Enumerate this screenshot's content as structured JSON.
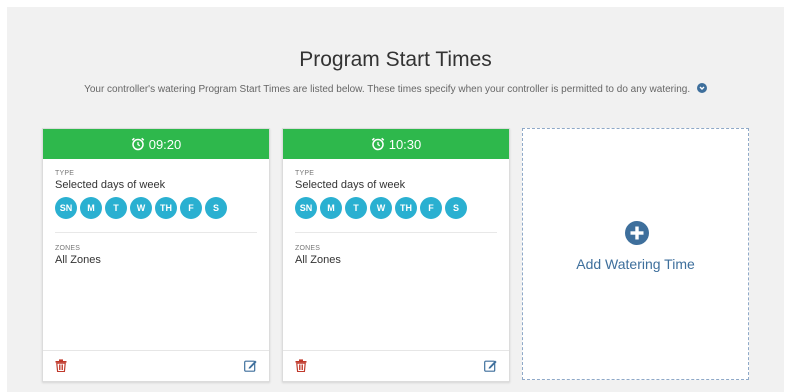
{
  "page": {
    "title": "Program Start Times",
    "subtitle": "Your controller's watering Program Start Times are listed below. These times specify when your controller is permitted to do any watering."
  },
  "cards": [
    {
      "time": "09:20",
      "type_label": "TYPE",
      "type_value": "Selected days of week",
      "days": [
        "SN",
        "M",
        "T",
        "W",
        "TH",
        "F",
        "S"
      ],
      "zones_label": "ZONES",
      "zones_value": "All Zones"
    },
    {
      "time": "10:30",
      "type_label": "TYPE",
      "type_value": "Selected days of week",
      "days": [
        "SN",
        "M",
        "T",
        "W",
        "TH",
        "F",
        "S"
      ],
      "zones_label": "ZONES",
      "zones_value": "All Zones"
    }
  ],
  "add_card": {
    "label": "Add Watering Time"
  },
  "colors": {
    "header_green": "#2eb84c",
    "day_blue": "#2ab0d1",
    "delete_red": "#c0392b",
    "link_blue": "#3e6f9c"
  },
  "icons": {
    "info": "info-circle-icon",
    "clock": "alarm-clock-icon",
    "delete": "trash-icon",
    "edit": "edit-icon",
    "add": "plus-circle-icon"
  }
}
